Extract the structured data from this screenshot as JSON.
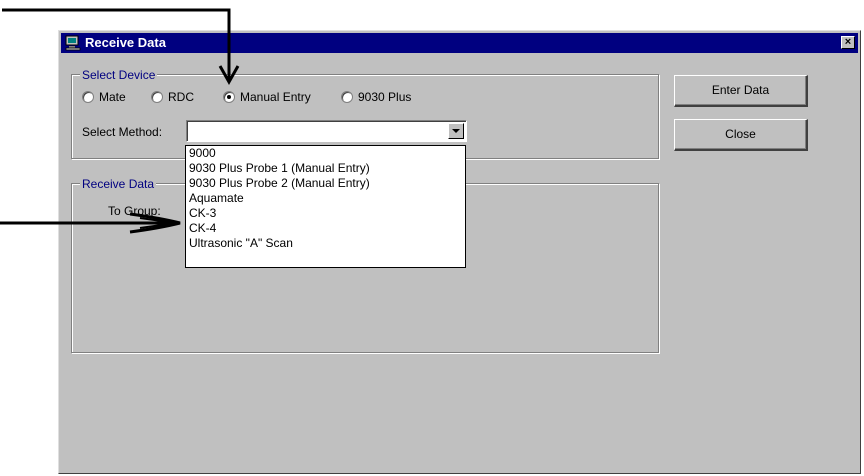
{
  "window": {
    "title": "Receive Data",
    "close_glyph": "×",
    "icon": "computer-icon"
  },
  "select_device": {
    "label": "Select Device",
    "radios": [
      {
        "label": "Mate",
        "checked": false
      },
      {
        "label": "RDC",
        "checked": false
      },
      {
        "label": "Manual Entry",
        "checked": true
      },
      {
        "label": "9030 Plus",
        "checked": false
      }
    ],
    "method_label": "Select Method:",
    "method_value": ""
  },
  "method_options": [
    "9000",
    "9030 Plus Probe 1 (Manual Entry)",
    "9030 Plus Probe 2 (Manual Entry)",
    "Aquamate",
    "CK-3",
    "CK-4",
    "Ultrasonic \"A\" Scan"
  ],
  "receive_data": {
    "label": "Receive Data",
    "to_group_label": "To Group:"
  },
  "buttons": {
    "enter_data": "Enter Data",
    "close": "Close"
  },
  "colors": {
    "titlebar": "#000080",
    "face": "#c0c0c0",
    "annotation_arrow": "#000000"
  }
}
